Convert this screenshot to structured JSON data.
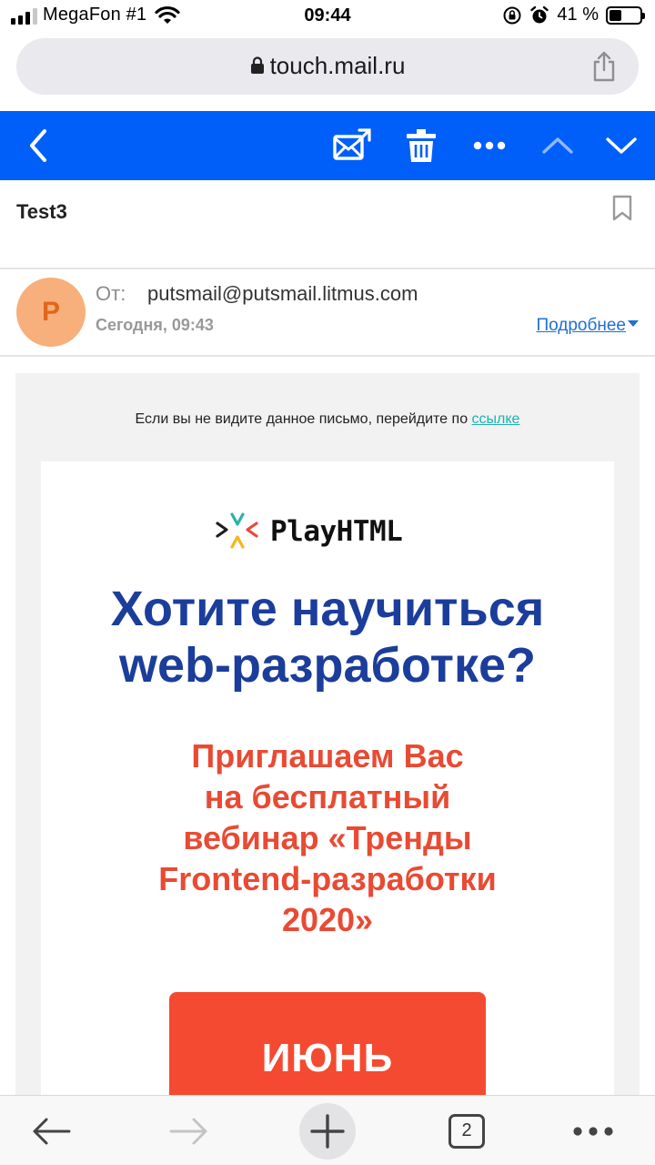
{
  "status_bar": {
    "carrier": "MegaFon #1",
    "time": "09:44",
    "battery": "41 %",
    "battery_level": 0.41
  },
  "browser": {
    "url": "touch.mail.ru",
    "tab_count": "2"
  },
  "mail": {
    "subject": "Test3",
    "from_label": "От:",
    "from_email": "putsmail@putsmail.litmus.com",
    "avatar_letter": "P",
    "date": "Сегодня, 09:43",
    "details_link": "Подробнее"
  },
  "email_body": {
    "preheader_text": "Если вы не видите данное письмо, перейдите по ",
    "preheader_link": "ссылке",
    "logo_text": "PlayHTML",
    "headline_line1": "Хотите научиться",
    "headline_line2": "web-разработке?",
    "subhead_lines": [
      "Приглашаем Вас",
      "на бесплатный",
      "вебинар «Тренды",
      "Frontend-разработки",
      "2020»"
    ],
    "cta_label": "ИЮНЬ"
  },
  "colors": {
    "toolbar": "#005ff9",
    "headline": "#1b3d9b",
    "subhead": "#e94a33",
    "cta": "#f44a31",
    "link": "#1ab3b0"
  }
}
